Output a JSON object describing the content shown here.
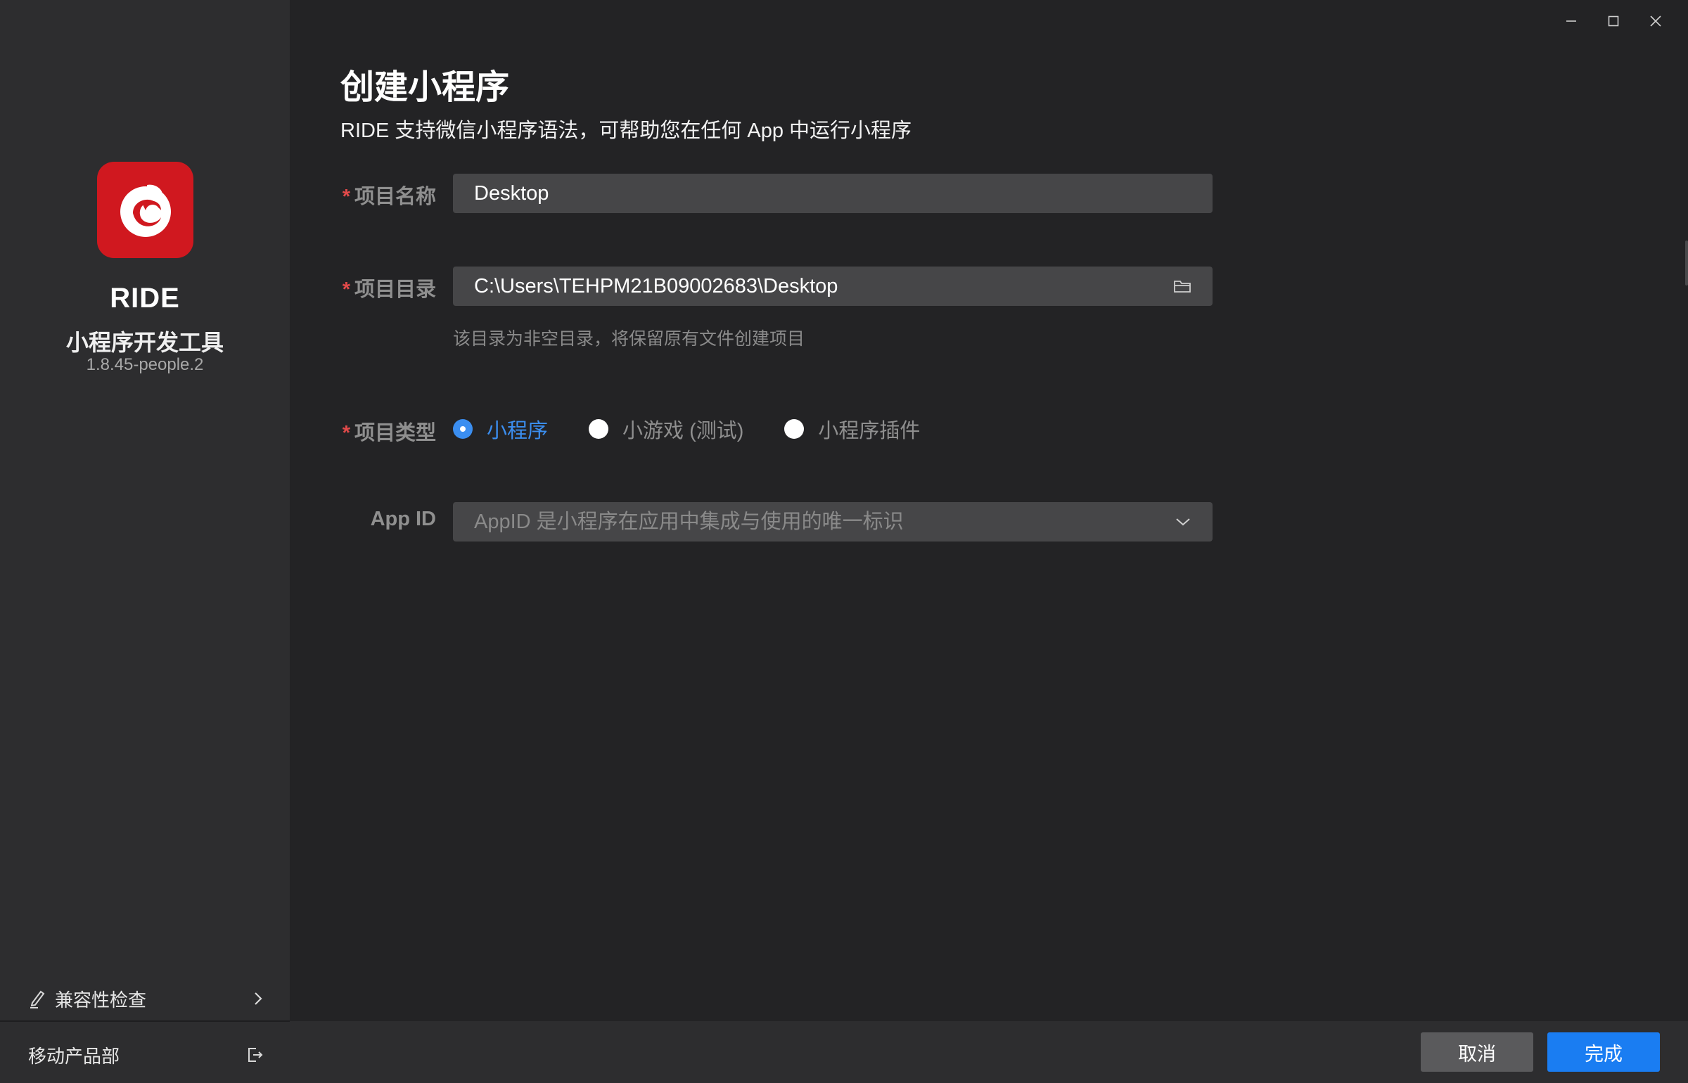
{
  "sidebar": {
    "app_name": "RIDE",
    "app_subtitle": "小程序开发工具",
    "version": "1.8.45-people.2",
    "compat_check_label": "兼容性检查",
    "org_name": "移动产品部"
  },
  "header": {
    "title": "创建小程序",
    "description": "RIDE 支持微信小程序语法，可帮助您在任何 App 中运行小程序"
  },
  "form": {
    "project_name": {
      "label": "项目名称",
      "value": "Desktop",
      "required": "*"
    },
    "project_dir": {
      "label": "项目目录",
      "value": "C:\\Users\\TEHPM21B09002683\\Desktop",
      "hint": "该目录为非空目录，将保留原有文件创建项目",
      "required": "*"
    },
    "project_type": {
      "label": "项目类型",
      "required": "*",
      "options": [
        {
          "label": "小程序",
          "checked": true
        },
        {
          "label": "小游戏 (测试)",
          "checked": false
        },
        {
          "label": "小程序插件",
          "checked": false
        }
      ]
    },
    "app_id": {
      "label": "App ID",
      "placeholder": "AppID 是小程序在应用中集成与使用的唯一标识"
    }
  },
  "footer": {
    "cancel_label": "取消",
    "done_label": "完成"
  },
  "colors": {
    "accent": "#1a7df2",
    "brand_red": "#d0181f",
    "required": "#e24a4a"
  },
  "icons": [
    "app-logo-icon",
    "edit-icon",
    "chevron-right-icon",
    "logout-icon",
    "folder-icon",
    "chevron-down-icon",
    "minimize-icon",
    "maximize-icon",
    "close-icon"
  ]
}
